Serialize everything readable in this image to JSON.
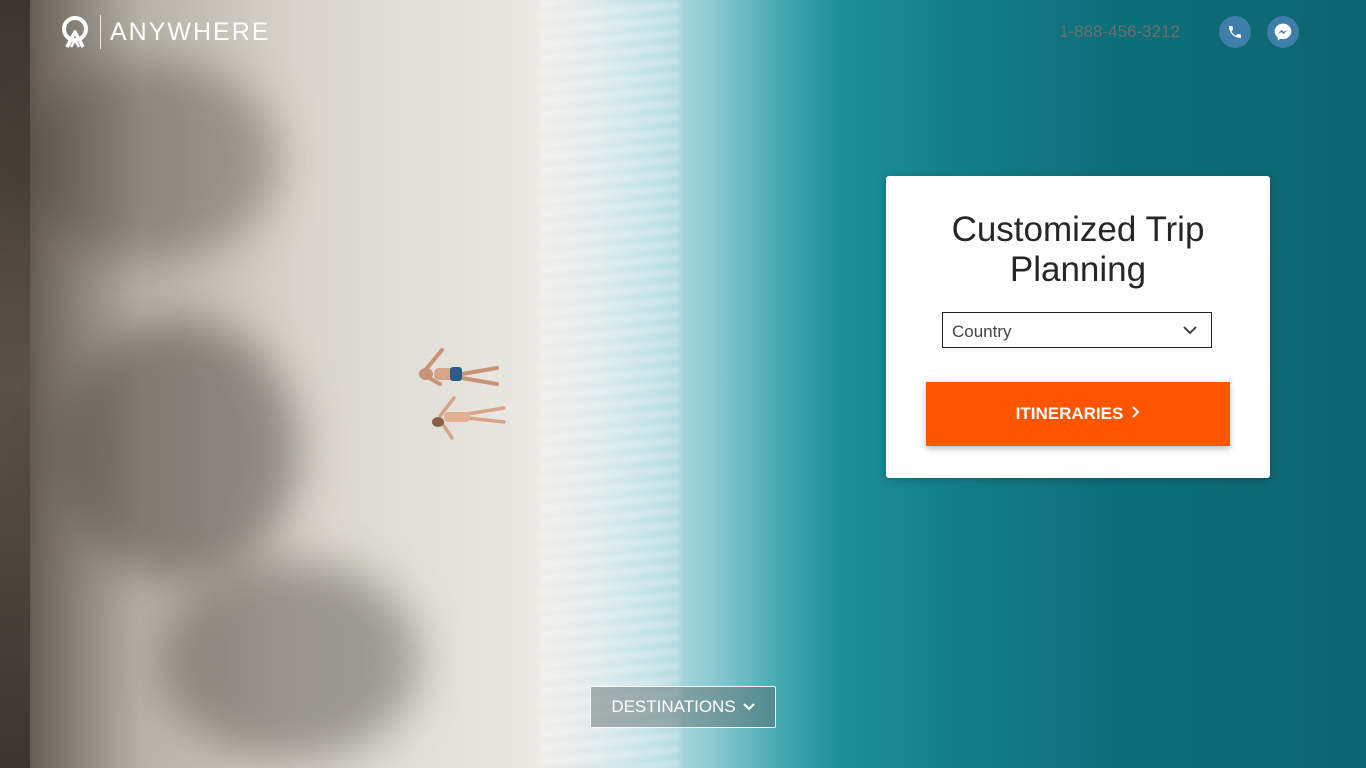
{
  "header": {
    "brand": "ANYWHERE",
    "phone": "1-888-456-3212",
    "icons": {
      "phone": "phone-icon",
      "messenger": "messenger-icon"
    }
  },
  "card": {
    "title_line1": "Customized Trip",
    "title_line2": "Planning",
    "country_select": "Country",
    "itineraries_label": "ITINERARIES"
  },
  "destinations_label": "DESTINATIONS",
  "colors": {
    "accent": "#ff5400",
    "icon_circle": "#3f7ea8",
    "ocean": "#137f89"
  }
}
